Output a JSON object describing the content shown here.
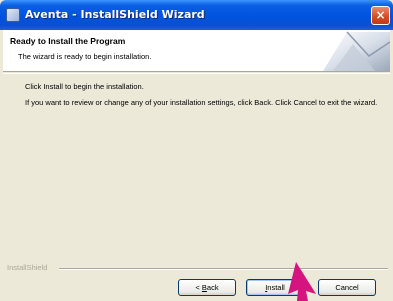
{
  "window": {
    "title": "Aventa - InstallShield Wizard",
    "close_glyph": "×"
  },
  "header": {
    "title": "Ready to Install the Program",
    "subtitle": "The wizard is ready to begin installation."
  },
  "body": {
    "line1": "Click Install to begin the installation.",
    "paragraph": "If you want to review or change any of your installation settings, click Back. Click Cancel to exit the wizard."
  },
  "footer": {
    "brand": "InstallShield"
  },
  "buttons": {
    "back_prefix": "< ",
    "back_mnemonic": "B",
    "back_rest": "ack",
    "install_mnemonic": "I",
    "install_rest": "nstall",
    "cancel": "Cancel"
  },
  "colors": {
    "titlebar": "#0053e0",
    "pointer": "#d6147f"
  },
  "icons": {
    "window": "installer-icon",
    "close": "close-icon",
    "header": "computer-graphic",
    "cursor": "arrow-pointer"
  }
}
